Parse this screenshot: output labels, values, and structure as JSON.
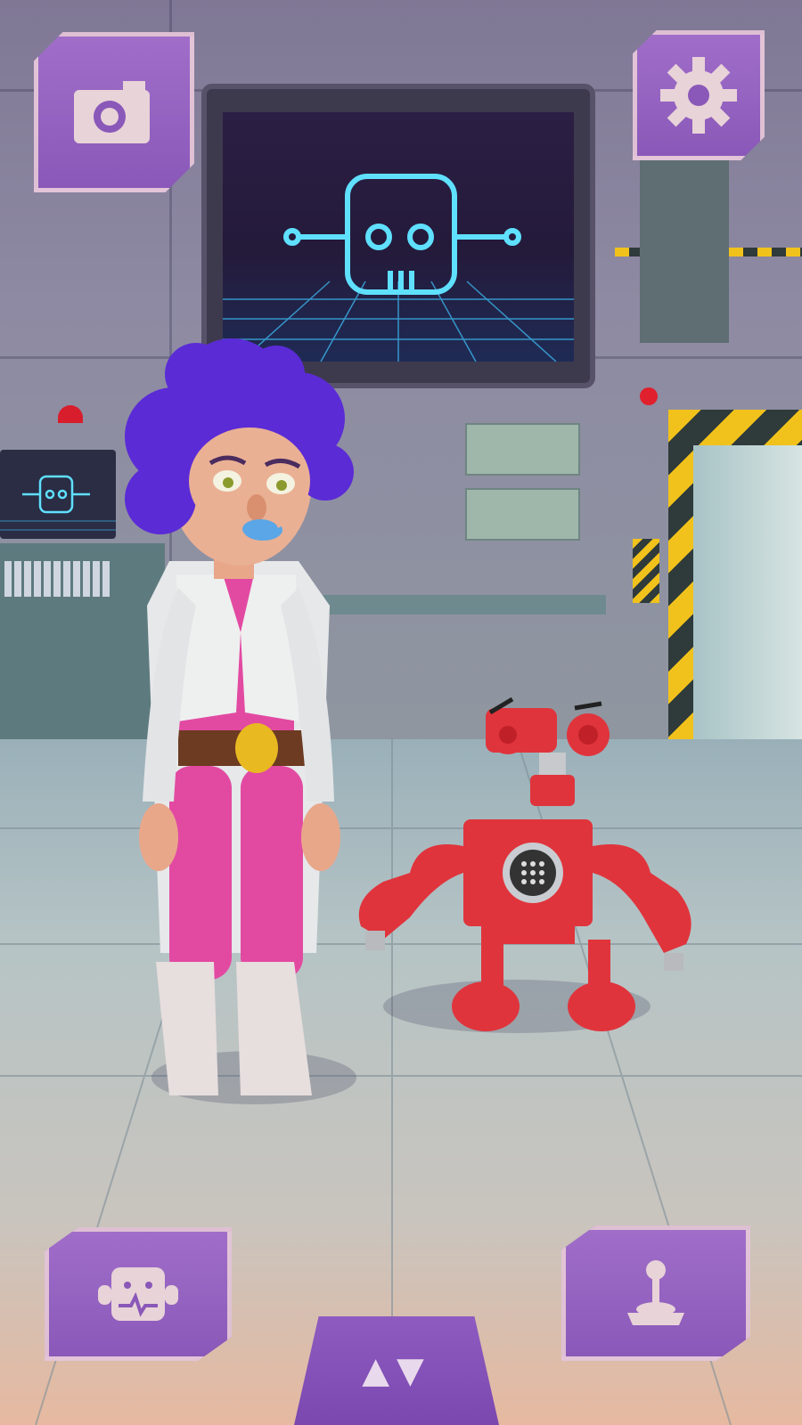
{
  "colors": {
    "hud_button": "#9a66c4",
    "hud_icon": "#e8d3d8",
    "hair": "#5b2bd6",
    "outfit_pink": "#e24aa2",
    "robot_red": "#e0343c",
    "hazard_yellow": "#f1c21b"
  },
  "scene": {
    "monitor_icon": "robot-face-icon",
    "characters": [
      "scientist-girl",
      "red-robot"
    ]
  },
  "hud": {
    "camera_button": {
      "icon": "camera-icon"
    },
    "settings_button": {
      "icon": "gear-icon"
    },
    "robot_status_button": {
      "icon": "robot-heartbeat-icon"
    },
    "controller_button": {
      "icon": "joystick-icon"
    },
    "nav_button": {
      "icon": "up-down-arrows-icon",
      "glyphs": "▲▼"
    }
  }
}
